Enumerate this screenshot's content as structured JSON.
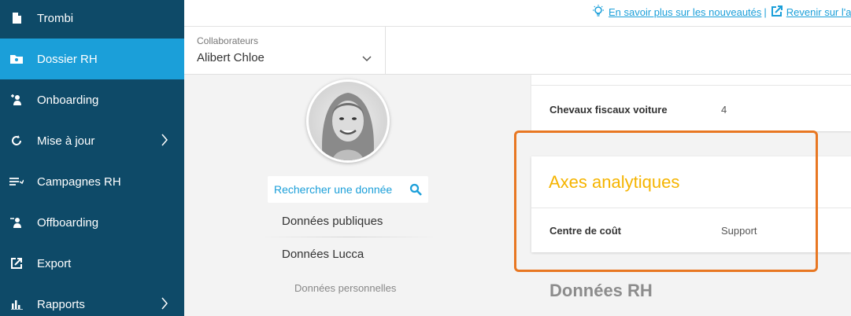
{
  "sidebar": {
    "items": [
      {
        "label": "Trombi",
        "icon": "document-icon"
      },
      {
        "label": "Dossier RH",
        "icon": "folder-icon",
        "active": true
      },
      {
        "label": "Onboarding",
        "icon": "user-plus-icon"
      },
      {
        "label": "Mise à jour",
        "icon": "refresh-icon",
        "chevron": true
      },
      {
        "label": "Campagnes RH",
        "icon": "list-icon"
      },
      {
        "label": "Offboarding",
        "icon": "user-minus-icon"
      },
      {
        "label": "Export",
        "icon": "export-icon"
      },
      {
        "label": "Rapports",
        "icon": "chart-icon",
        "chevron": true
      }
    ]
  },
  "topbar": {
    "news_link": "En savoir plus sur les nouveautés",
    "separator": "|",
    "back_link": "Revenir sur l'a"
  },
  "selector": {
    "label": "Collaborateurs",
    "value": "Alibert Chloe"
  },
  "search": {
    "placeholder": "Rechercher une donnée"
  },
  "sections": {
    "public": "Données publiques",
    "lucca": "Données Lucca",
    "personal": "Données personnelles"
  },
  "fields": {
    "cv_label": "Chevaux fiscaux voiture",
    "cv_value": "4"
  },
  "axes": {
    "title": "Axes analytiques",
    "cost_label": "Centre de coût",
    "cost_value": "Support"
  },
  "hr_section": {
    "title": "Données RH"
  },
  "colors": {
    "sidebar": "#0e4a68",
    "active": "#1b9fd9",
    "accent": "#f5b400",
    "highlight": "#e87722"
  }
}
